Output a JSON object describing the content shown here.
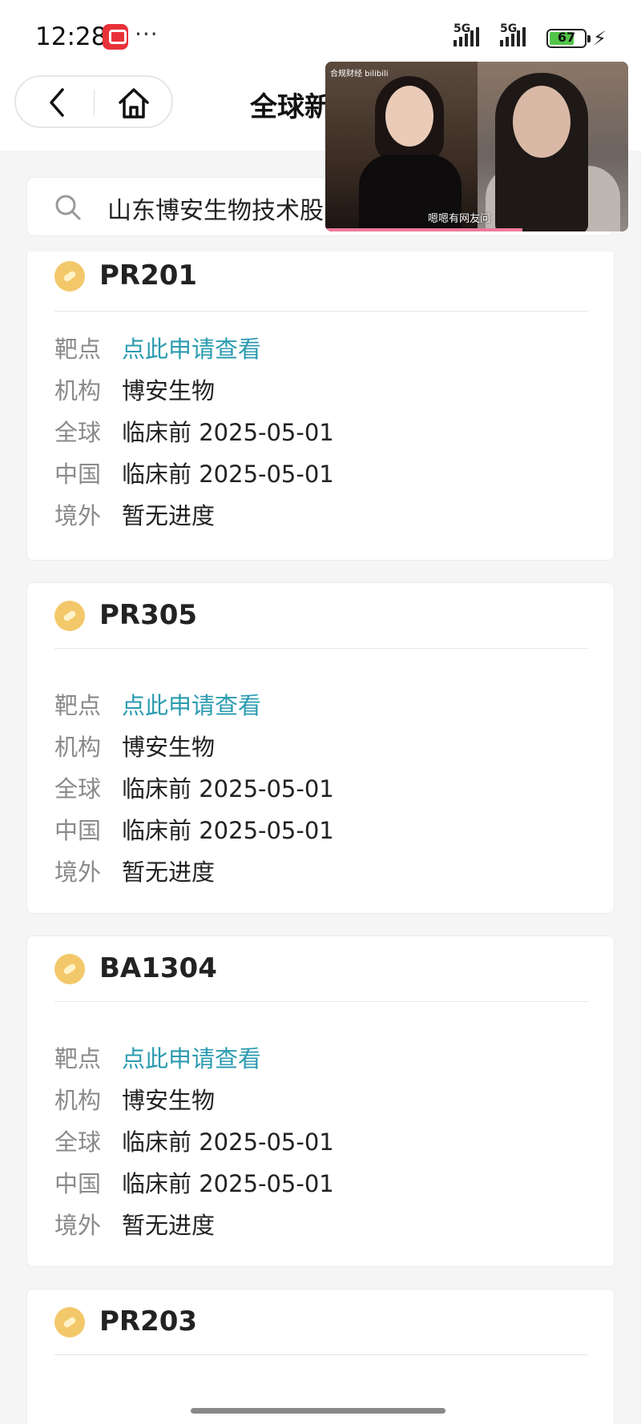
{
  "status_bar": {
    "time": "12:28",
    "overflow": "···",
    "signal1_label": "5G",
    "signal2_label": "5G",
    "battery": "67"
  },
  "nav": {
    "title": "全球新"
  },
  "search": {
    "value": "山东博安生物技术股"
  },
  "video": {
    "watermark": "合规财经 bilibili",
    "caption": "嗯嗯有网友问"
  },
  "cards": [
    {
      "title": "PR201",
      "rows": [
        {
          "key": "靶点",
          "value": "点此申请查看"
        },
        {
          "key": "机构",
          "value": "博安生物"
        },
        {
          "key": "全球",
          "value": "临床前 2025-05-01"
        },
        {
          "key": "中国",
          "value": "临床前 2025-05-01"
        },
        {
          "key": "境外",
          "value": "暂无进度"
        }
      ]
    },
    {
      "title": "PR305",
      "rows": [
        {
          "key": "靶点",
          "value": "点此申请查看"
        },
        {
          "key": "机构",
          "value": "博安生物"
        },
        {
          "key": "全球",
          "value": "临床前 2025-05-01"
        },
        {
          "key": "中国",
          "value": "临床前 2025-05-01"
        },
        {
          "key": "境外",
          "value": "暂无进度"
        }
      ]
    },
    {
      "title": "BA1304",
      "rows": [
        {
          "key": "靶点",
          "value": "点此申请查看"
        },
        {
          "key": "机构",
          "value": "博安生物"
        },
        {
          "key": "全球",
          "value": "临床前 2025-05-01"
        },
        {
          "key": "中国",
          "value": "临床前 2025-05-01"
        },
        {
          "key": "境外",
          "value": "暂无进度"
        }
      ]
    },
    {
      "title": "PR203",
      "rows": []
    }
  ],
  "icons": {
    "back": "chevron-left-icon",
    "home": "home-icon",
    "search": "search-icon",
    "card": "pill-icon"
  },
  "colors": {
    "link": "#2b9bb0",
    "pill": "#f3c86a",
    "battery": "#51c449"
  }
}
